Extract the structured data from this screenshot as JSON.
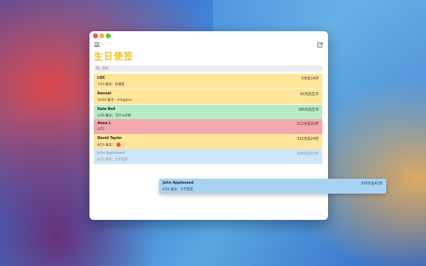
{
  "app": {
    "title": "生日便签"
  },
  "search": {
    "placeholder": "搜索"
  },
  "rows": [
    {
      "name": "LQC",
      "detail": "7/23 备注：好朋友",
      "badge": "5天后14岁",
      "color": "#fde59a"
    },
    {
      "name": "Dannel",
      "detail": "10/18 备注：d-higgins",
      "badge": "92天后生日",
      "color": "#fde59a"
    },
    {
      "name": "Kate Bell",
      "detail": "1/26 备注：写什么好呢",
      "badge": "185天后生日",
      "color": "#b6ebc6"
    },
    {
      "name": "Anna L",
      "detail": "2/15",
      "badge": "212天后20岁",
      "color": "#f2a8ae"
    },
    {
      "name": "David Taylor",
      "detail": "6/15 备注：",
      "badge": "332天后24岁",
      "color": "#fde59a"
    },
    {
      "name": "John Appleseed",
      "detail": "6/22 备注：大学室友",
      "badge": "339天后42岁",
      "color": "#cfe6f8"
    }
  ],
  "drag_row": {
    "name": "John Appleseed",
    "detail": "6/22 备注：大学室友",
    "badge": "339天后42岁"
  },
  "icons": {
    "menu": "menu-icon",
    "compose": "compose-icon",
    "search": "search-icon",
    "smiley": "emoji-icon"
  },
  "colors": {
    "title": "#f2c12e",
    "yellow": "#fde59a",
    "green": "#b6ebc6",
    "red": "#f2a8ae",
    "blue": "#cfe6f8"
  }
}
